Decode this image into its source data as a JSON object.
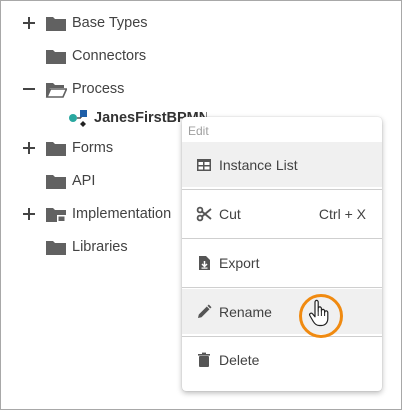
{
  "tree": {
    "items": [
      {
        "label": "Base Types",
        "toggle": "plus",
        "icon": "folder-icon"
      },
      {
        "label": "Connectors",
        "toggle": "none",
        "icon": "folder-icon"
      },
      {
        "label": "Process",
        "toggle": "minus",
        "icon": "folder-open-icon"
      },
      {
        "label": "JanesFirstBPMN",
        "toggle": "none",
        "icon": "bpmn-process-icon"
      },
      {
        "label": "Forms",
        "toggle": "plus",
        "icon": "folder-icon"
      },
      {
        "label": "API",
        "toggle": "none",
        "icon": "folder-icon"
      },
      {
        "label": "Implementation",
        "toggle": "plus",
        "icon": "implementation-folder-icon"
      },
      {
        "label": "Libraries",
        "toggle": "none",
        "icon": "folder-icon"
      }
    ]
  },
  "context_menu": {
    "header": "Edit",
    "items": [
      {
        "label": "Instance List",
        "icon": "table-icon",
        "shortcut": ""
      },
      {
        "label": "Cut",
        "icon": "scissors-icon",
        "shortcut": "Ctrl + X"
      },
      {
        "label": "Export",
        "icon": "export-file-icon",
        "shortcut": ""
      },
      {
        "label": "Rename",
        "icon": "pencil-icon",
        "shortcut": ""
      },
      {
        "label": "Delete",
        "icon": "trash-icon",
        "shortcut": ""
      }
    ]
  },
  "colors": {
    "folder": "#616161",
    "highlight": "#f0f0f0",
    "cursor_ring": "#f08a10",
    "bpmn_blue": "#1f5fa8",
    "bpmn_teal": "#2aa8a0"
  }
}
